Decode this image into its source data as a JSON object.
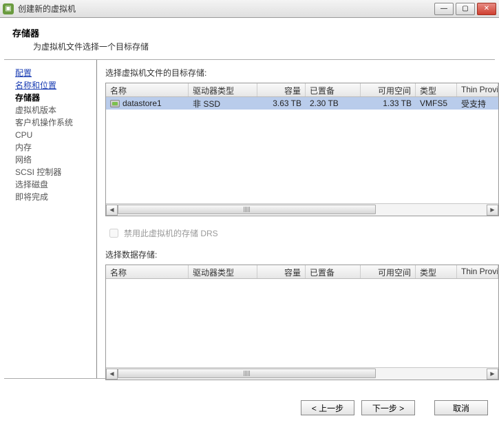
{
  "window": {
    "title": "创建新的虚拟机",
    "min": "—",
    "max": "▢",
    "close": "✕"
  },
  "header": {
    "title": "存储器",
    "subtitle": "为虚拟机文件选择一个目标存储"
  },
  "sidebar": {
    "items": [
      {
        "label": "配置",
        "kind": "link"
      },
      {
        "label": "名称和位置",
        "kind": "link"
      },
      {
        "label": "存储器",
        "kind": "active"
      },
      {
        "label": "虚拟机版本",
        "kind": "disabled"
      },
      {
        "label": "客户机操作系统",
        "kind": "disabled"
      },
      {
        "label": "CPU",
        "kind": "disabled"
      },
      {
        "label": "内存",
        "kind": "disabled"
      },
      {
        "label": "网络",
        "kind": "disabled"
      },
      {
        "label": "SCSI 控制器",
        "kind": "disabled"
      },
      {
        "label": "选择磁盘",
        "kind": "disabled"
      },
      {
        "label": "即将完成",
        "kind": "disabled"
      }
    ]
  },
  "main": {
    "top_label": "选择虚拟机文件的目标存储:",
    "columns": {
      "name": "名称",
      "drive_type": "驱动器类型",
      "capacity": "容量",
      "provisioned": "已置备",
      "free": "可用空间",
      "type": "类型",
      "thin": "Thin Provi"
    },
    "rows": [
      {
        "name": "datastore1",
        "drive_type": "非 SSD",
        "capacity": "3.63 TB",
        "provisioned": "2.30 TB",
        "free": "1.33 TB",
        "type": "VMFS5",
        "thin": "受支持"
      }
    ],
    "drs_checkbox": "禁用此虚拟机的存储 DRS",
    "bottom_label": "选择数据存储:"
  },
  "footer": {
    "back": "< 上一步",
    "next": "下一步 >",
    "cancel": "取消"
  }
}
